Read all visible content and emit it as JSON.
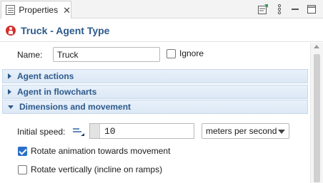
{
  "tab": {
    "label": "Properties",
    "close_glyph": "✕",
    "icon": "properties-icon"
  },
  "toolbar": {
    "icons": [
      "pin-view-icon",
      "view-menu-icon",
      "minimize-icon",
      "maximize-icon"
    ]
  },
  "header": {
    "title": "Truck - Agent Type",
    "icon": "agent-type-icon",
    "accent": "#2d5a8c"
  },
  "name_field": {
    "label": "Name:",
    "value": "Truck"
  },
  "ignore": {
    "label": "Ignore",
    "checked": false
  },
  "sections": [
    {
      "label": "Agent actions",
      "expanded": false
    },
    {
      "label": "Agent in flowcharts",
      "expanded": false
    },
    {
      "label": "Dimensions and movement",
      "expanded": true
    }
  ],
  "initial_speed": {
    "label": "Initial speed:",
    "value": "10",
    "unit": "meters per second",
    "mode_icon": "static-value-icon"
  },
  "rotate_animation": {
    "label": "Rotate animation towards movement",
    "checked": true
  },
  "rotate_vertically": {
    "label": "Rotate vertically (incline on ramps)",
    "checked": false
  }
}
